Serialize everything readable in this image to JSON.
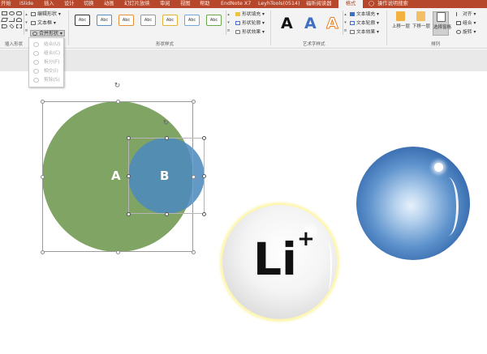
{
  "tabs": [
    "开始",
    "iSlide",
    "插入",
    "设计",
    "切换",
    "动画",
    "幻灯片放映",
    "审阅",
    "视图",
    "帮助",
    "EndNote X7",
    "LeyhTools(0514)",
    "福昕阅读器",
    "格式",
    "操作说明搜索"
  ],
  "active_tab": "格式",
  "groups": {
    "insert_shapes": {
      "label": "插入形状",
      "edit_shape": "编辑形状",
      "text_box": "文本框",
      "merge_shapes": "合并形状"
    },
    "shape_styles": {
      "label": "形状样式",
      "sample": "Abc",
      "fill": "形状填充",
      "outline": "形状轮廓",
      "effects": "形状效果"
    },
    "wordart": {
      "label": "艺术字样式",
      "sample": "A",
      "fill": "文本填充",
      "outline": "文本轮廓",
      "effects": "文本效果"
    },
    "arrange": {
      "label": "排列",
      "bring_forward": "上移一层",
      "send_backward": "下移一层",
      "selection_pane": "选择窗格",
      "align": "对齐",
      "group": "组合",
      "rotate": "旋转"
    }
  },
  "merge_menu": {
    "items": [
      "结合(U)",
      "组合(C)",
      "拆分(F)",
      "相交(I)",
      "剪除(S)"
    ]
  },
  "slide": {
    "circle_a_label": "A",
    "circle_b_label": "B",
    "li_text": "Li",
    "li_superscript": "+"
  },
  "colors": {
    "ribbon_accent": "#b7472a",
    "circle_a": "#7fa464",
    "circle_b": "#4f8abd",
    "blue_ball": "#2f63a8"
  }
}
